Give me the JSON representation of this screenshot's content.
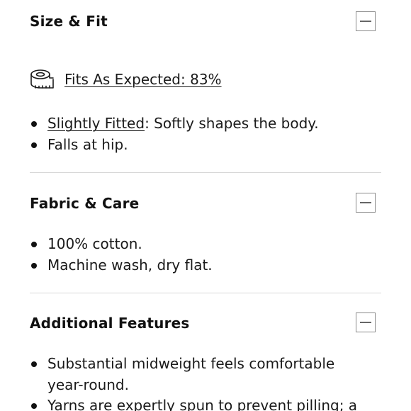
{
  "size_fit": {
    "title": "Size & Fit",
    "fit_link": "Fits As Expected: 83%",
    "fit_icon": "measuring-tape-icon",
    "bullets": [
      {
        "link": "Slightly Fitted",
        "text": ": Softly shapes the body."
      },
      {
        "text": "Falls at hip."
      }
    ]
  },
  "fabric_care": {
    "title": "Fabric & Care",
    "bullets": [
      {
        "text": "100% cotton."
      },
      {
        "text": "Machine wash, dry flat."
      }
    ]
  },
  "additional_features": {
    "title": "Additional Features",
    "bullets": [
      {
        "text": "Substantial midweight feels comfortable year-round."
      },
      {
        "text": "Yarns are expertly spun to prevent pilling; a"
      }
    ]
  },
  "icons": {
    "collapse": "minus-icon"
  }
}
